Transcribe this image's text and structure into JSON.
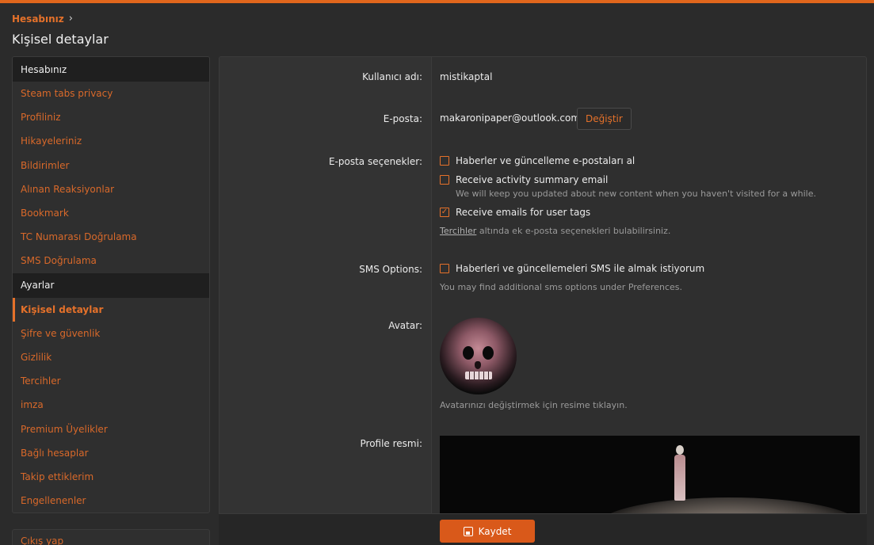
{
  "breadcrumb": {
    "root": "Hesabınız"
  },
  "page_title": "Kişisel detaylar",
  "sidebar": {
    "section1_header": "Hesabınız",
    "section1_items": [
      "Steam tabs privacy",
      "Profiliniz",
      "Hikayeleriniz",
      "Bildirimler",
      "Alınan Reaksiyonlar",
      "Bookmark",
      "TC Numarası Doğrulama",
      "SMS Doğrulama"
    ],
    "section2_header": "Ayarlar",
    "section2_items": [
      "Kişisel detaylar",
      "Şifre ve güvenlik",
      "Gizlilik",
      "Tercihler",
      "imza",
      "Premium Üyelikler",
      "Bağlı hesaplar",
      "Takip ettiklerim",
      "Engellenenler"
    ],
    "logout": "Çıkış yap"
  },
  "form": {
    "username_label": "Kullanıcı adı:",
    "username_value": "mistikaptal",
    "email_label": "E-posta:",
    "email_value": "makaronipaper@outlook.com",
    "change_button": "Değiştir",
    "email_options_label": "E-posta seçenekler:",
    "email_options": [
      {
        "label": "Haberler ve güncelleme e-postaları al",
        "checked": false
      },
      {
        "label": "Receive activity summary email",
        "checked": false,
        "hint": "We will keep you updated about new content when you haven't visited for a while."
      },
      {
        "label": "Receive emails for user tags",
        "checked": true
      }
    ],
    "email_pref_link": "Tercihler",
    "email_pref_text": " altında ek e-posta seçenekleri bulabilirsiniz.",
    "sms_label": "SMS Options:",
    "sms_option": "Haberleri ve güncellemeleri SMS ile almak istiyorum",
    "sms_hint": "You may find additional sms options under Preferences.",
    "avatar_label": "Avatar:",
    "avatar_hint": "Avatarınızı değiştirmek için resime tıklayın.",
    "profile_image_label": "Profile resmi:",
    "save_button": "Kaydet"
  },
  "colors": {
    "accent": "#e5712a",
    "top_bar": "#e0661c",
    "background": "#2b2b2b"
  },
  "icons": {
    "save": "save-icon",
    "checkbox_checked": "check-icon",
    "breadcrumb_sep": "chevron-right-icon"
  }
}
